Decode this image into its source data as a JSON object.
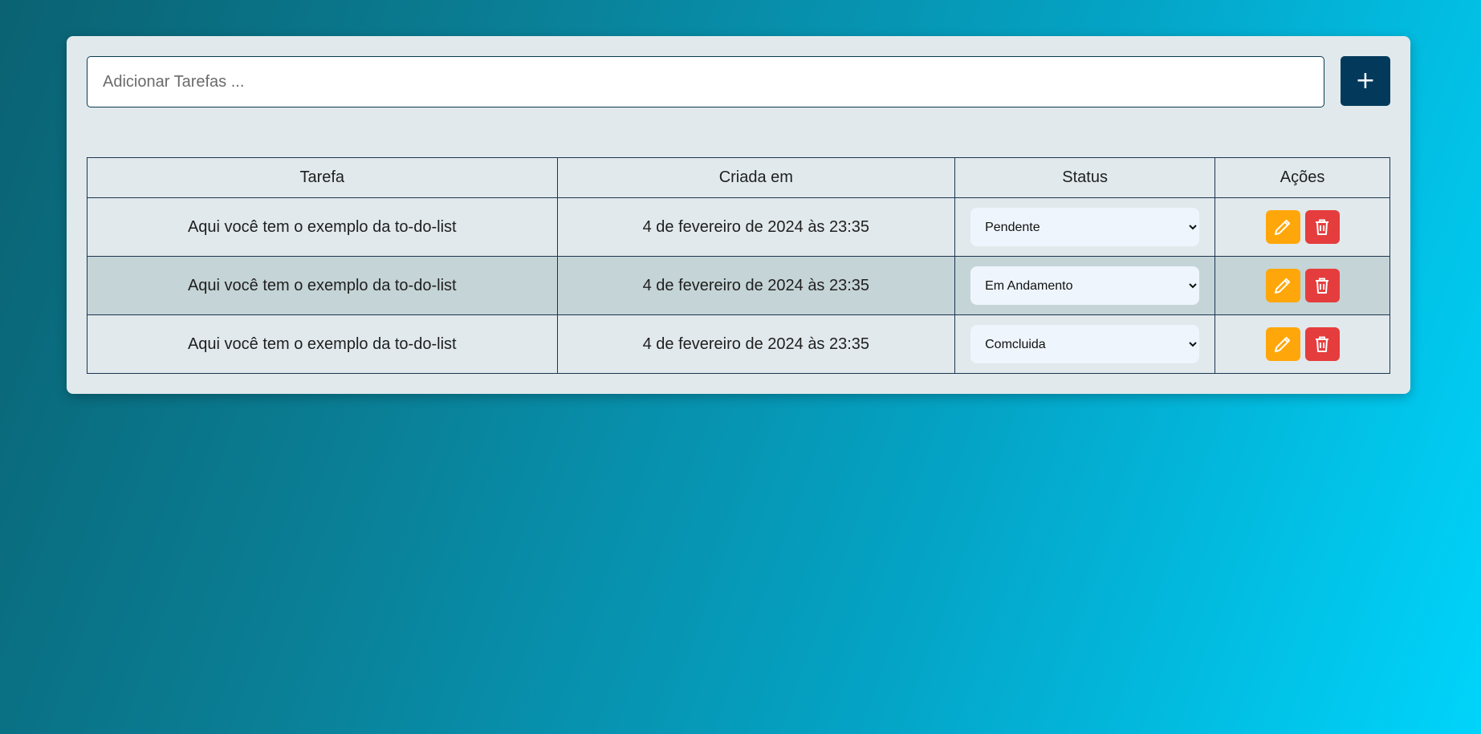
{
  "add_task": {
    "placeholder": "Adicionar Tarefas ...",
    "value": "",
    "button_label": "+"
  },
  "table": {
    "headers": {
      "task": "Tarefa",
      "created": "Criada em",
      "status": "Status",
      "actions": "Ações"
    },
    "rows": [
      {
        "task": "Aqui você tem o exemplo da to-do-list",
        "created": "4 de fevereiro de 2024 às 23:35",
        "status": "Pendente"
      },
      {
        "task": "Aqui você tem o exemplo da to-do-list",
        "created": "4 de fevereiro de 2024 às 23:35",
        "status": "Em Andamento"
      },
      {
        "task": "Aqui você tem o exemplo da to-do-list",
        "created": "4 de fevereiro de 2024 às 23:35",
        "status": "Comcluida"
      }
    ]
  },
  "icons": {
    "edit": "pencil-icon",
    "delete": "trash-icon"
  },
  "colors": {
    "add_button": "#033a5c",
    "edit_button": "#ffa70a",
    "delete_button": "#e53d3d",
    "card_background": "#e1e9ec",
    "highlight_row": "#c5d4d6"
  }
}
